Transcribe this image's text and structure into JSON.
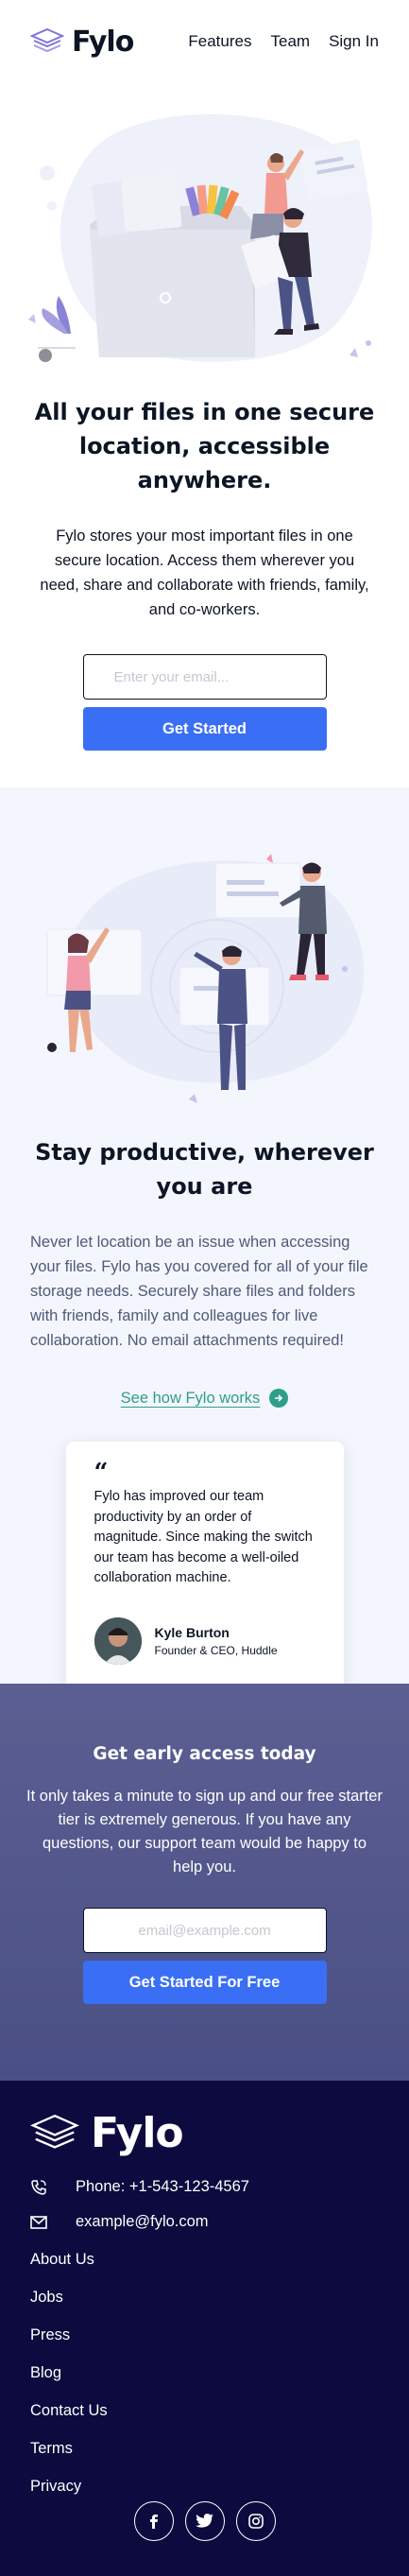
{
  "header": {
    "logo_text": "Fylo",
    "nav": [
      "Features",
      "Team",
      "Sign In"
    ]
  },
  "hero": {
    "title": "All your files in one secure location, accessible anywhere.",
    "description": "Fylo stores your most important files in one secure location. Access them wherever you need, share and collaborate with friends, family, and co-workers.",
    "email_placeholder": "Enter your email...",
    "cta_label": "Get Started"
  },
  "productive": {
    "title": "Stay productive, wherever you are",
    "description": "Never let location be an issue when accessing your files. Fylo has you covered for all of your file storage needs. Securely share files and folders with friends, family and colleagues for live collaboration. No email attachments required!",
    "link_label": "See how Fylo works",
    "testimonial": {
      "quote_mark": "“",
      "quote": "Fylo has improved our team productivity by an order of magnitude. Since making the switch our team has become a well-oiled collaboration machine.",
      "name": "Kyle Burton",
      "role": "Founder & CEO, Huddle"
    }
  },
  "access": {
    "title": "Get early access today",
    "description": "It only takes a minute to sign up and our free starter tier is extremely generous. If you have any questions, our support team would be happy to help you.",
    "email_placeholder": "email@example.com",
    "cta_label": "Get Started For Free"
  },
  "footer": {
    "logo_text": "Fylo",
    "phone": "Phone: +1-543-123-4567",
    "email": "example@fylo.com",
    "links": [
      "About Us",
      "Jobs",
      "Press",
      "Blog",
      "Contact Us",
      "Terms",
      "Privacy"
    ],
    "socials": [
      "facebook-icon",
      "twitter-icon",
      "instagram-icon"
    ]
  },
  "colors": {
    "primary_blue": "#3a6ff5",
    "dark_navy": "#0c0a3e",
    "teal_link": "#2d9f89",
    "section_tint": "#f4f6fd",
    "access_bg": "#5b5f92"
  }
}
